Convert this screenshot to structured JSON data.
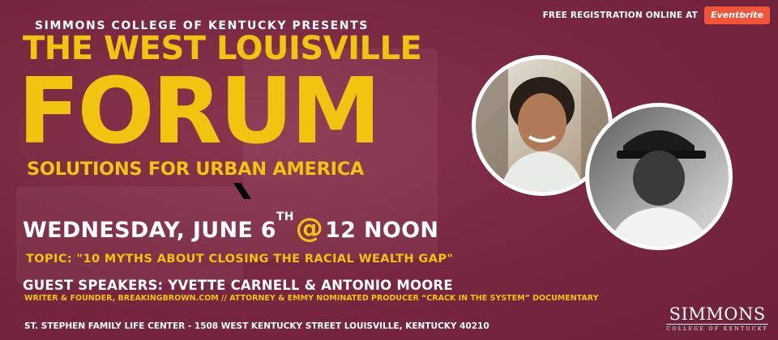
{
  "header": {
    "registration_label": "FREE REGISTRATION ONLINE AT",
    "eventbrite_label": "Eventbrite",
    "presenter": "SIMMONS COLLEGE OF KENTUCKY PRESENTS"
  },
  "title": {
    "line1": "THE WEST LOUISVILLE",
    "main": "FORUM",
    "subtitle": "SOLUTIONS FOR URBAN AMERICA"
  },
  "event": {
    "date_prefix": "WEDNESDAY, JUNE 6",
    "date_suffix": "TH",
    "at_symbol": "@",
    "time": "12 NOON",
    "topic": "TOPIC: \"10 MYTHS ABOUT CLOSING THE RACIAL WEALTH GAP\"",
    "guests": "GUEST SPEAKERS: YVETTE CARNELL & ANTONIO MOORE",
    "credits": "WRITER & FOUNDER, BREAKINGBROWN.COM // ATTORNEY & EMMY NOMINATED PRODUCER “CRACK IN THE SYSTEM” DOCUMENTARY",
    "location": "ST. STEPHEN FAMILY LIFE CENTER - 1508 WEST KENTUCKY STREET LOUISVILLE, KENTUCKY 40210"
  },
  "logo": {
    "main": "SIMMONS",
    "sub": "COLLEGE OF KENTUCKY"
  },
  "colors": {
    "background": "#7a2540",
    "accent_yellow": "#f1c40f",
    "eventbrite_orange": "#f05537"
  },
  "icons": {
    "eventbrite": "eventbrite-logo",
    "speaker1": "speaker-photo-woman",
    "speaker2": "speaker-photo-man"
  }
}
